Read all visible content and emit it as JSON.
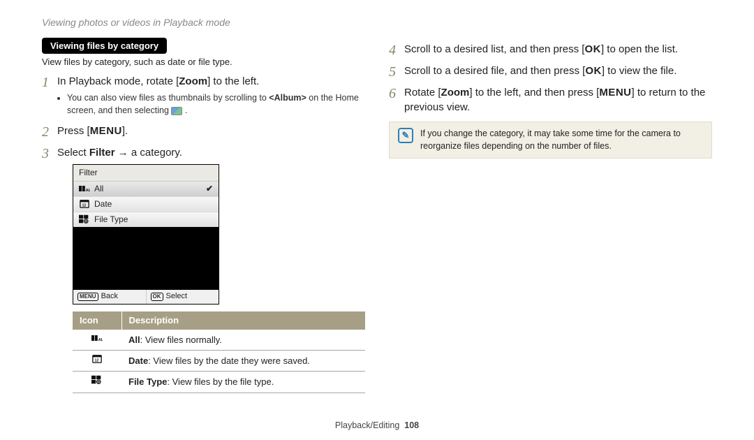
{
  "header": {
    "title": "Viewing photos or videos in Playback mode"
  },
  "left": {
    "section_pill": "Viewing files by category",
    "section_sub": "View files by category, such as date or file type.",
    "step1_a": "In Playback mode, rotate [",
    "step1_zoom": "Zoom",
    "step1_b": "] to the left.",
    "step1_bullet_a": "You can also view files as thumbnails by scrolling to ",
    "step1_bullet_album": "<Album>",
    "step1_bullet_b": " on the Home screen, and then selecting ",
    "step1_bullet_c": " .",
    "step2_a": "Press [",
    "step2_menu": "MENU",
    "step2_b": "].",
    "step3_a": "Select ",
    "step3_filter": "Filter",
    "step3_b": " → a category.",
    "device": {
      "title": "Filter",
      "rows": [
        {
          "label": "All",
          "selected": true
        },
        {
          "label": "Date",
          "selected": false
        },
        {
          "label": "File Type",
          "selected": false
        }
      ],
      "back_btn": "MENU",
      "back_label": "Back",
      "select_btn": "OK",
      "select_label": "Select"
    },
    "table": {
      "h1": "Icon",
      "h2": "Description",
      "rows": [
        {
          "bold": "All",
          "rest": ": View files normally."
        },
        {
          "bold": "Date",
          "rest": ": View files by the date they were saved."
        },
        {
          "bold": "File Type",
          "rest": ": View files by the file type."
        }
      ]
    }
  },
  "right": {
    "step4_a": "Scroll to a desired list, and then press [",
    "step4_ok": "OK",
    "step4_b": "] to open the list.",
    "step5_a": "Scroll to a desired file, and then press [",
    "step5_ok": "OK",
    "step5_b": "] to view the file.",
    "step6_a": "Rotate [",
    "step6_zoom": "Zoom",
    "step6_b": "] to the left, and then press [",
    "step6_menu": "MENU",
    "step6_c": "] to return to the previous view.",
    "note_icon": "✎",
    "note": "If you change the category, it may take some time for the camera to reorganize files depending on the number of files."
  },
  "footer": {
    "section": "Playback/Editing",
    "page": "108"
  }
}
